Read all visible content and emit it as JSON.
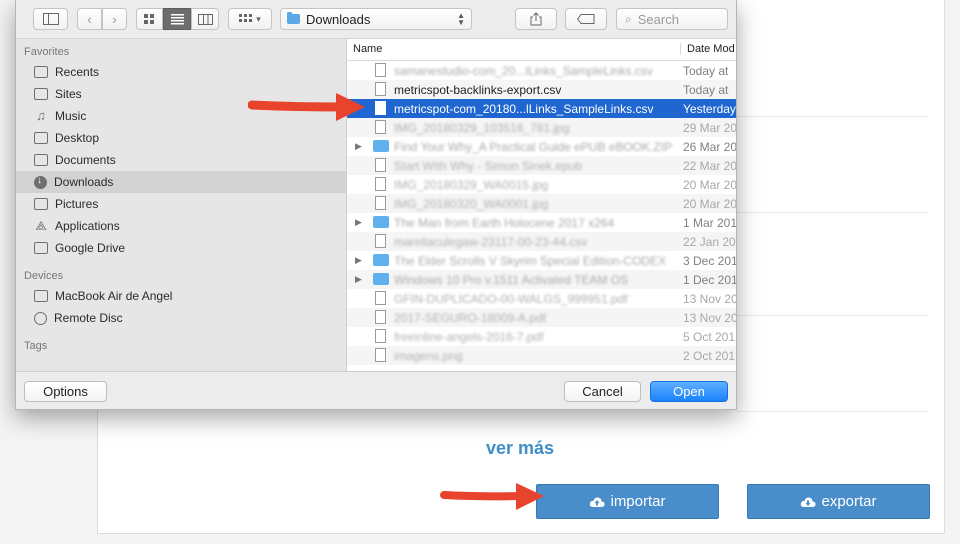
{
  "dialog": {
    "location": "Downloads",
    "search_placeholder": "Search",
    "columns": {
      "name": "Name",
      "date": "Date Mod"
    },
    "sidebar": {
      "favorites_label": "Favorites",
      "favorites": [
        {
          "label": "Recents",
          "icon": "recents-icon"
        },
        {
          "label": "Sites",
          "icon": "folder-icon"
        },
        {
          "label": "Music",
          "icon": "music-icon"
        },
        {
          "label": "Desktop",
          "icon": "desktop-icon"
        },
        {
          "label": "Documents",
          "icon": "documents-icon"
        },
        {
          "label": "Downloads",
          "icon": "downloads-icon",
          "selected": true
        },
        {
          "label": "Pictures",
          "icon": "camera-icon"
        },
        {
          "label": "Applications",
          "icon": "applications-icon"
        },
        {
          "label": "Google Drive",
          "icon": "folder-icon"
        }
      ],
      "devices_label": "Devices",
      "devices": [
        {
          "label": "MacBook Air de Angel",
          "icon": "laptop-icon"
        },
        {
          "label": "Remote Disc",
          "icon": "disc-icon"
        }
      ],
      "tags_label": "Tags"
    },
    "files": [
      {
        "name": "samanestudio-com_20...lLinks_SampleLinks.csv",
        "date": "Today at",
        "type": "file",
        "blurred": true
      },
      {
        "name": "metricspot-backlinks-export.csv",
        "date": "Today at",
        "type": "file"
      },
      {
        "name": "metricspot-com_20180...lLinks_SampleLinks.csv",
        "date": "Yesterday",
        "type": "file",
        "selected": true
      },
      {
        "name": "IMG_20180329_103516_781.jpg",
        "date": "29 Mar 20",
        "type": "file",
        "blurred": true,
        "dim": true
      },
      {
        "name": "Find Your Why_A Practical Guide ePUB eBOOK.ZIP",
        "date": "26 Mar 20",
        "type": "folder",
        "blurred": true
      },
      {
        "name": "Start With Why - Simon Sinek.epub",
        "date": "22 Mar 20",
        "type": "file",
        "blurred": true,
        "dim": true
      },
      {
        "name": "IMG_20180329_WA0015.jpg",
        "date": "20 Mar 20",
        "type": "file",
        "blurred": true,
        "dim": true
      },
      {
        "name": "IMG_20180320_WA0001.jpg",
        "date": "20 Mar 20",
        "type": "file",
        "blurred": true,
        "dim": true
      },
      {
        "name": "The Man from Earth Holocene 2017 x264",
        "date": "1 Mar 201",
        "type": "folder",
        "blurred": true
      },
      {
        "name": "mareliaculegaw-23117-00-23-44.csv",
        "date": "22 Jan 20",
        "type": "file",
        "blurred": true,
        "dim": true
      },
      {
        "name": "The Elder Scrolls V Skyrim Special Edition-CODEX",
        "date": "3 Dec 201",
        "type": "folder",
        "blurred": true
      },
      {
        "name": "Windows 10 Pro v.1511 Activated TEAM OS",
        "date": "1 Dec 201",
        "type": "folder",
        "blurred": true
      },
      {
        "name": "GFIN-DUPLICADO-00-WALGS_999951.pdf",
        "date": "13 Nov 20",
        "type": "file",
        "blurred": true,
        "dim": true
      },
      {
        "name": "2017-SEGURO-18009-A.pdf",
        "date": "13 Nov 20",
        "type": "file",
        "blurred": true,
        "dim": true
      },
      {
        "name": "freeinline-angels-2016-7.pdf",
        "date": "5 Oct 201",
        "type": "file",
        "blurred": true,
        "dim": true
      },
      {
        "name": "imagens.png",
        "date": "2 Oct 201",
        "type": "file",
        "blurred": true,
        "dim": true
      }
    ],
    "options_label": "Options",
    "cancel_label": "Cancel",
    "open_label": "Open"
  },
  "page": {
    "ver_mas": "ver más",
    "importar_label": "importar",
    "exportar_label": "exportar"
  },
  "colors": {
    "accent": "#4a8dcb",
    "selection": "#1f66d1",
    "arrow": "#e8432c"
  }
}
